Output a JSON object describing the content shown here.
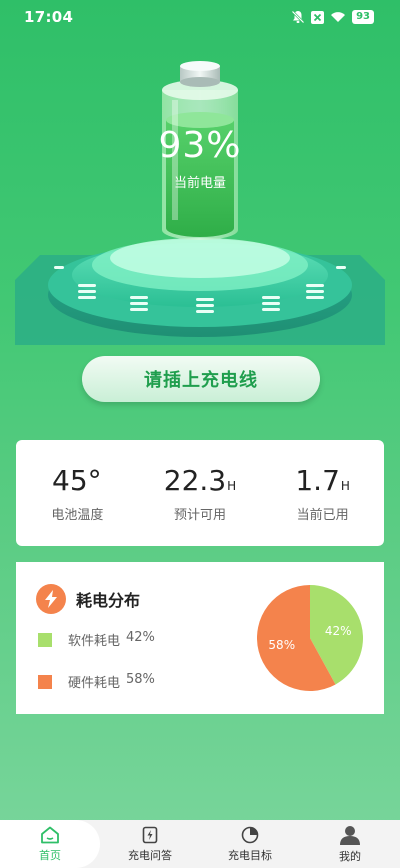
{
  "status_bar": {
    "time": "17:04",
    "battery": "93"
  },
  "hero": {
    "percent": "93%",
    "label": "当前电量"
  },
  "plug_button": "请插上充电线",
  "stats": [
    {
      "value": "45°",
      "unit": "",
      "label": "电池温度"
    },
    {
      "value": "22.3",
      "unit": "H",
      "label": "预计可用"
    },
    {
      "value": "1.7",
      "unit": "H",
      "label": "当前已用"
    }
  ],
  "consumption": {
    "title": "耗电分布",
    "software": {
      "label": "软件耗电",
      "percent": "42%",
      "value": 42,
      "color": "#a8df6c"
    },
    "hardware": {
      "label": "硬件耗电",
      "percent": "58%",
      "value": 58,
      "color": "#f4834c"
    }
  },
  "nav": [
    {
      "label": "首页",
      "icon": "home-icon",
      "active": true
    },
    {
      "label": "充电问答",
      "icon": "charge-doc-icon",
      "active": false
    },
    {
      "label": "充电目标",
      "icon": "pie-target-icon",
      "active": false
    },
    {
      "label": "我的",
      "icon": "person-icon",
      "active": false
    }
  ],
  "colors": {
    "accent": "#2fbf68",
    "software": "#a8df6c",
    "hardware": "#f4834c"
  }
}
